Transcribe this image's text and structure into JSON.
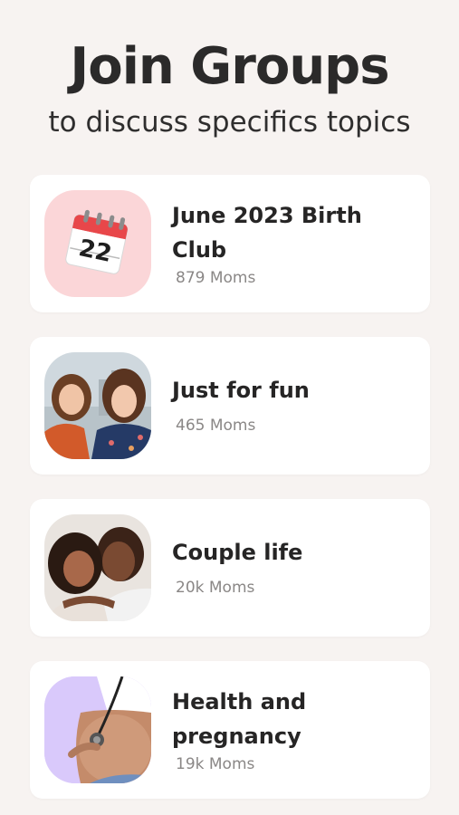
{
  "header": {
    "title": "Join Groups",
    "subtitle": "to discuss specifics topics"
  },
  "groups": [
    {
      "name": "June 2023 Birth Club",
      "members": "879 Moms",
      "icon": "calendar-icon"
    },
    {
      "name": "Just for fun",
      "members": "465 Moms",
      "icon": "friends-photo"
    },
    {
      "name": "Couple life",
      "members": "20k Moms",
      "icon": "couple-photo"
    },
    {
      "name": "Health and pregnancy",
      "members": "19k Moms",
      "icon": "pregnancy-photo"
    }
  ],
  "calendar": {
    "day": "22"
  },
  "colors": {
    "background": "#f7f3f1",
    "card": "#ffffff",
    "text": "#2b2a2a",
    "muted": "#8a8786",
    "calendar_bg": "#fbd6d8",
    "pregnancy_bg": "#d9c9fb"
  }
}
